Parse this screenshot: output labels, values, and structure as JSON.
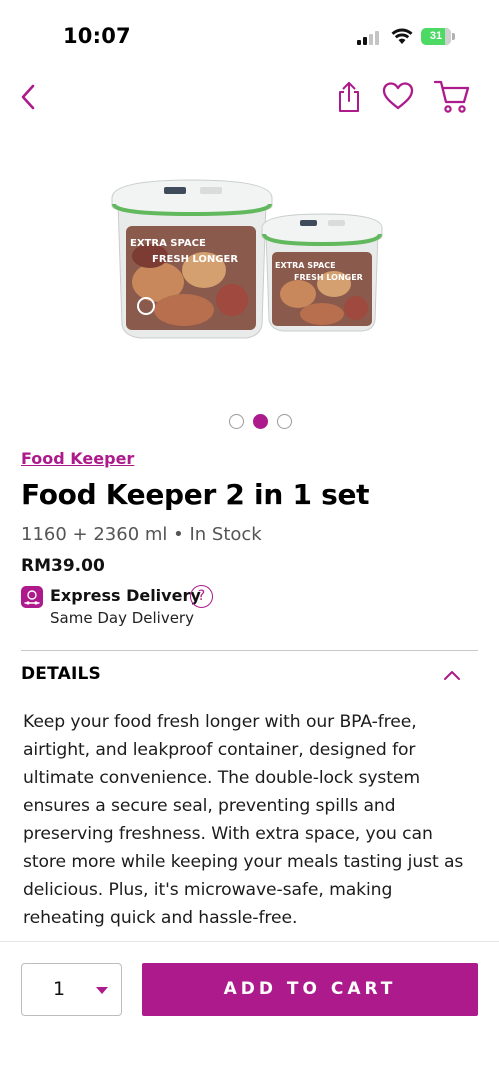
{
  "status_bar": {
    "time": "10:07",
    "battery_level": "31"
  },
  "nav": {
    "icons": [
      "back-icon",
      "share-icon",
      "heart-icon",
      "cart-icon"
    ]
  },
  "product": {
    "image_text": {
      "large_label_line1": "EXTRA SPACE",
      "large_label_line2": "FRESH LONGER",
      "small_label_line1": "EXTRA SPACE",
      "small_label_line2": "FRESH LONGER"
    },
    "carousel": {
      "total": 3,
      "active_index": 1
    },
    "brand": "Food Keeper",
    "title": "Food Keeper 2 in 1 set",
    "subtitle": "1160 + 2360 ml • In Stock",
    "price": "RM39.00",
    "delivery": {
      "label": "Express Delivery",
      "help": "?",
      "sub_label": "Same Day Delivery"
    }
  },
  "details": {
    "header": "DETAILS",
    "expanded": true,
    "body": "Keep your food fresh longer with our BPA-free, airtight, and leakproof container, designed for ultimate convenience. The double-lock system ensures a secure seal, preventing spills and preserving freshness. With extra space, you can store more while keeping your meals tasting just as delicious. Plus, it's microwave-safe, making reheating quick and hassle-free."
  },
  "bottom_bar": {
    "quantity": "1",
    "add_to_cart_label": "ADD TO CART"
  },
  "colors": {
    "accent": "#ad1a8c",
    "text": "#111111",
    "muted": "#555555",
    "battery": "#4cd964"
  }
}
